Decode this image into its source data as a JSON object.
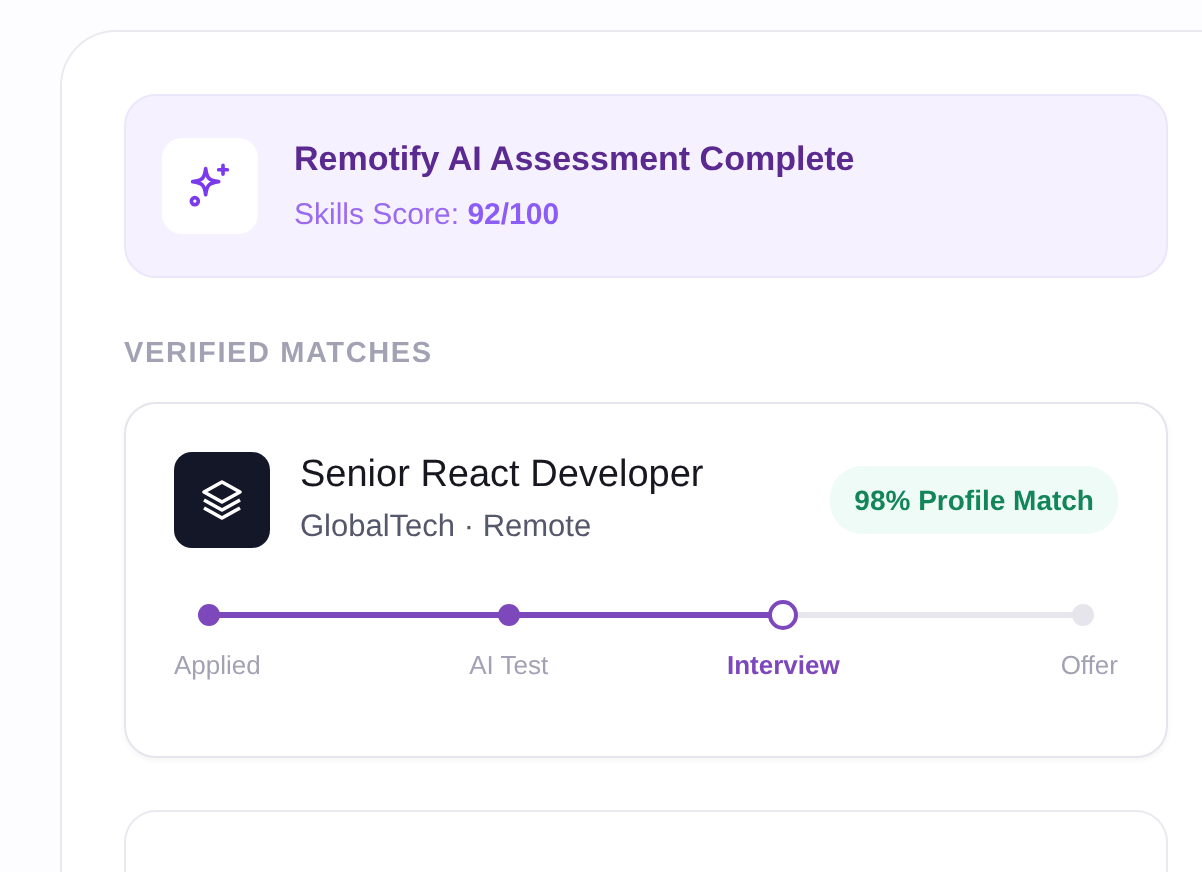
{
  "assessment": {
    "title": "Remotify AI Assessment Complete",
    "score_label": "Skills Score:",
    "score": "92/100"
  },
  "section_label": "VERIFIED MATCHES",
  "job": {
    "title": "Senior React Developer",
    "subtitle": "GlobalTech · Remote",
    "match": "98% Profile Match",
    "steps": [
      {
        "label": "Applied",
        "kind": "done"
      },
      {
        "label": "AI Test",
        "kind": "done"
      },
      {
        "label": "Interview",
        "kind": "current"
      },
      {
        "label": "Offer",
        "kind": "pending"
      }
    ]
  }
}
